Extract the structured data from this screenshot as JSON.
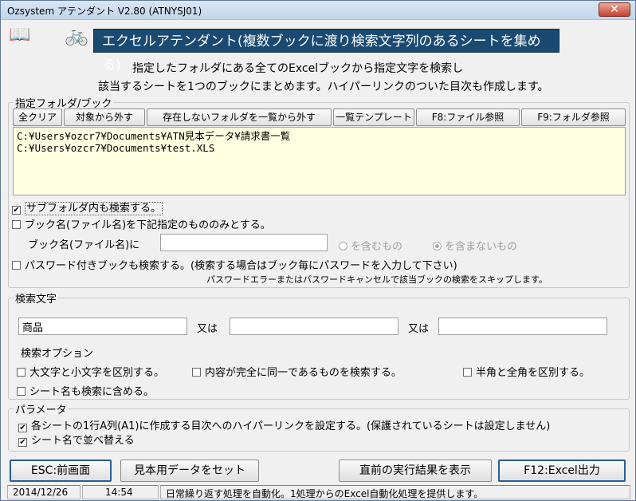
{
  "window": {
    "title": "Ozsystem アテンダント V2.80 (ATNYSJ01)",
    "close_label": "✕"
  },
  "banner": "エクセルアテンダント(複数ブックに渡り検索文字列のあるシートを集める)",
  "description": [
    "指定したフォルダにある全てのExcelブックから指定文字を検索し",
    "該当するシートを1つのブックにまとめます。ハイパーリンクのついた目次も作成します。"
  ],
  "folder_group": {
    "label": "指定フォルダ/ブック",
    "buttons": [
      "全クリア",
      "対象から外す",
      "存在しないフォルダを一覧から外す",
      "一覧テンプレート",
      "F8:ファイル参照",
      "F9:フォルダ参照"
    ],
    "folders": [
      "C:¥Users¥ozcr7¥Documents¥ATN見本データ¥請求書一覧",
      "C:¥Users¥ozcr7¥Documents¥test.XLS"
    ],
    "subfolder_label": "サブフォルダ内も検索する。",
    "subfolder_checked": true,
    "book_name_only_label": "ブック名(ファイル名)を下記指定のもののみとする。",
    "book_name_only_checked": false,
    "book_name_field_label": "ブック名(ファイル名)に",
    "book_name_value": "",
    "contains_label": "を含むもの",
    "not_contains_label": "を含まないもの",
    "password_label": "パスワード付きブックも検索する。(検索する場合はブック毎にパスワードを入力して下さい)",
    "password_checked": false,
    "password_note": "パスワードエラーまたはパスワードキャンセルで該当ブックの検索をスキップします。"
  },
  "search_group": {
    "label": "検索文字",
    "term1": "商品",
    "or_label": "又は",
    "term2": "",
    "term3": "",
    "options_label": "検索オプション",
    "opt_case": "大文字と小文字を区別する。",
    "opt_exact": "内容が完全に同一であるものを検索する。",
    "opt_width": "半角と全角を区別する。",
    "opt_sheetname": "シート名も検索に含める。"
  },
  "param_group": {
    "label": "パラメータ",
    "hyperlink_label": "各シートの1行A列(A1)に作成する目次へのハイパーリンクを設定する。(保護されているシートは設定しません)",
    "hyperlink_checked": true,
    "sort_label": "シート名で並べ替える",
    "sort_checked": true
  },
  "bottom_buttons": {
    "esc": "ESC:前画面",
    "sample": "見本用データをセット",
    "last_result": "直前の実行結果を表示",
    "excel_out": "F12:Excel出力"
  },
  "status": {
    "date": "2014/12/26",
    "time": "14:54",
    "message": "日常繰り返す処理を自動化。1処理からのExcel自動化処理を提供します。"
  },
  "check_glyph": "✔",
  "icons": {
    "help": "📖",
    "bike": "🚲"
  }
}
